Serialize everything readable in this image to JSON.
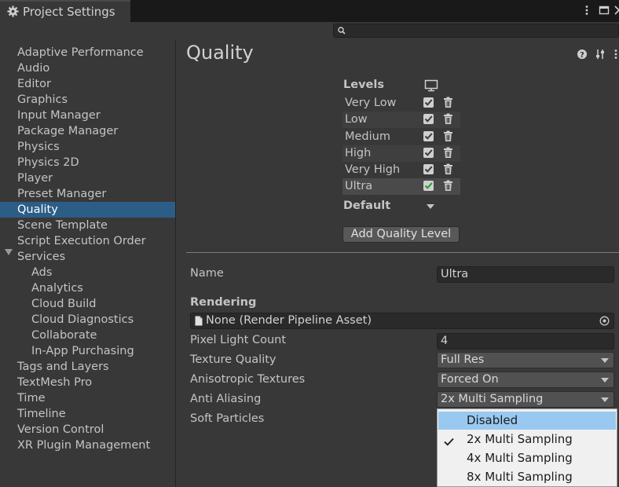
{
  "window": {
    "title": "Project Settings",
    "tab_icon": "gear-icon",
    "controls": [
      "more-icon",
      "maximize-icon",
      "close-icon"
    ]
  },
  "search": {
    "placeholder": "",
    "icon": "search-icon"
  },
  "sidebar": {
    "items": [
      {
        "label": "Adaptive Performance"
      },
      {
        "label": "Audio"
      },
      {
        "label": "Editor"
      },
      {
        "label": "Graphics"
      },
      {
        "label": "Input Manager"
      },
      {
        "label": "Package Manager"
      },
      {
        "label": "Physics"
      },
      {
        "label": "Physics 2D"
      },
      {
        "label": "Player"
      },
      {
        "label": "Preset Manager"
      },
      {
        "label": "Quality",
        "selected": true
      },
      {
        "label": "Scene Template"
      },
      {
        "label": "Script Execution Order"
      },
      {
        "label": "Services",
        "expanded": true
      },
      {
        "label": "Ads",
        "child": true
      },
      {
        "label": "Analytics",
        "child": true
      },
      {
        "label": "Cloud Build",
        "child": true
      },
      {
        "label": "Cloud Diagnostics",
        "child": true
      },
      {
        "label": "Collaborate",
        "child": true
      },
      {
        "label": "In-App Purchasing",
        "child": true
      },
      {
        "label": "Tags and Layers"
      },
      {
        "label": "TextMesh Pro"
      },
      {
        "label": "Time"
      },
      {
        "label": "Timeline"
      },
      {
        "label": "Version Control"
      },
      {
        "label": "XR Plugin Management"
      }
    ]
  },
  "main": {
    "title": "Quality",
    "header_icons": [
      "help-icon",
      "preset-icon",
      "menu-icon"
    ],
    "levels": {
      "heading": "Levels",
      "platform_icon": "monitor-icon",
      "rows": [
        {
          "name": "Very Low",
          "enabled": true
        },
        {
          "name": "Low",
          "enabled": true
        },
        {
          "name": "Medium",
          "enabled": true
        },
        {
          "name": "High",
          "enabled": true
        },
        {
          "name": "Very High",
          "enabled": true
        },
        {
          "name": "Ultra",
          "enabled": true,
          "selected": true
        }
      ],
      "default_label": "Default",
      "add_button": "Add Quality Level"
    },
    "settings": {
      "name_label": "Name",
      "name_value": "Ultra",
      "rendering_heading": "Rendering",
      "render_pipeline_value": "None (Render Pipeline Asset)",
      "pixel_light_count_label": "Pixel Light Count",
      "pixel_light_count_value": "4",
      "texture_quality_label": "Texture Quality",
      "texture_quality_value": "Full Res",
      "anisotropic_label": "Anisotropic Textures",
      "anisotropic_value": "Forced On",
      "anti_aliasing_label": "Anti Aliasing",
      "anti_aliasing_value": "2x Multi Sampling",
      "soft_particles_label": "Soft Particles"
    },
    "anti_aliasing_menu": {
      "options": [
        {
          "label": "Disabled",
          "highlighted": true
        },
        {
          "label": "2x Multi Sampling",
          "checked": true
        },
        {
          "label": "4x Multi Sampling"
        },
        {
          "label": "8x Multi Sampling"
        }
      ]
    }
  },
  "colors": {
    "selection": "#2c5d87",
    "menu_highlight": "#99c9f0",
    "checkbox_green": "#1fa01f"
  }
}
